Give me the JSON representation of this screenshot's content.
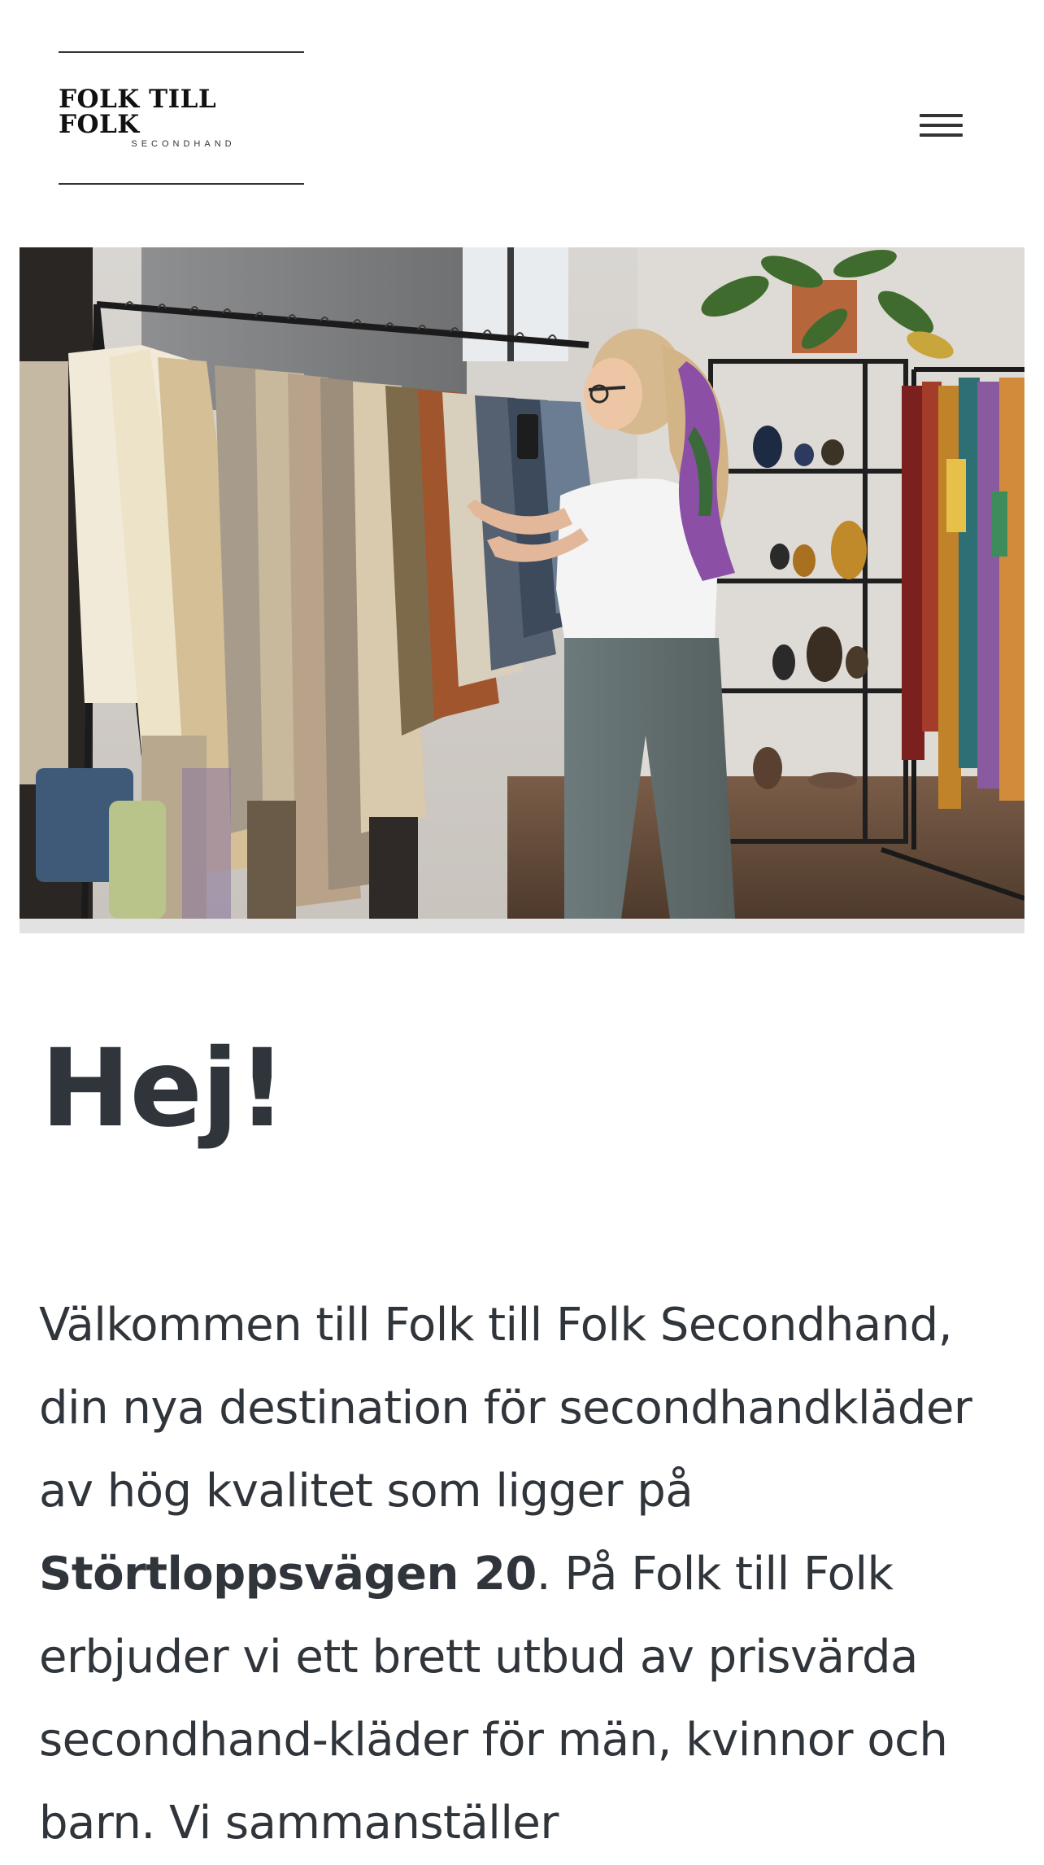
{
  "header": {
    "logo_main": "FOLK TILL FOLK",
    "logo_sub": "SECONDHAND",
    "menu_icon": "hamburger-menu-icon"
  },
  "hero": {
    "image_subject": "woman browsing clothing rack in secondhand shop"
  },
  "main": {
    "heading": "Hej!",
    "intro_before": "Välkommen till Folk till Folk Secondhand, din nya destination för secondhandkläder av hög kvalitet som ligger på ",
    "intro_bold": "Störtloppsvägen 20",
    "intro_after": ". På Folk till Folk erbjuder vi ett brett utbud av prisvärda secondhand-kläder för män, kvinnor och barn. Vi sammanställer"
  },
  "colors": {
    "text": "#30353b",
    "background": "#ffffff",
    "image_frame": "#e2e2e2"
  }
}
